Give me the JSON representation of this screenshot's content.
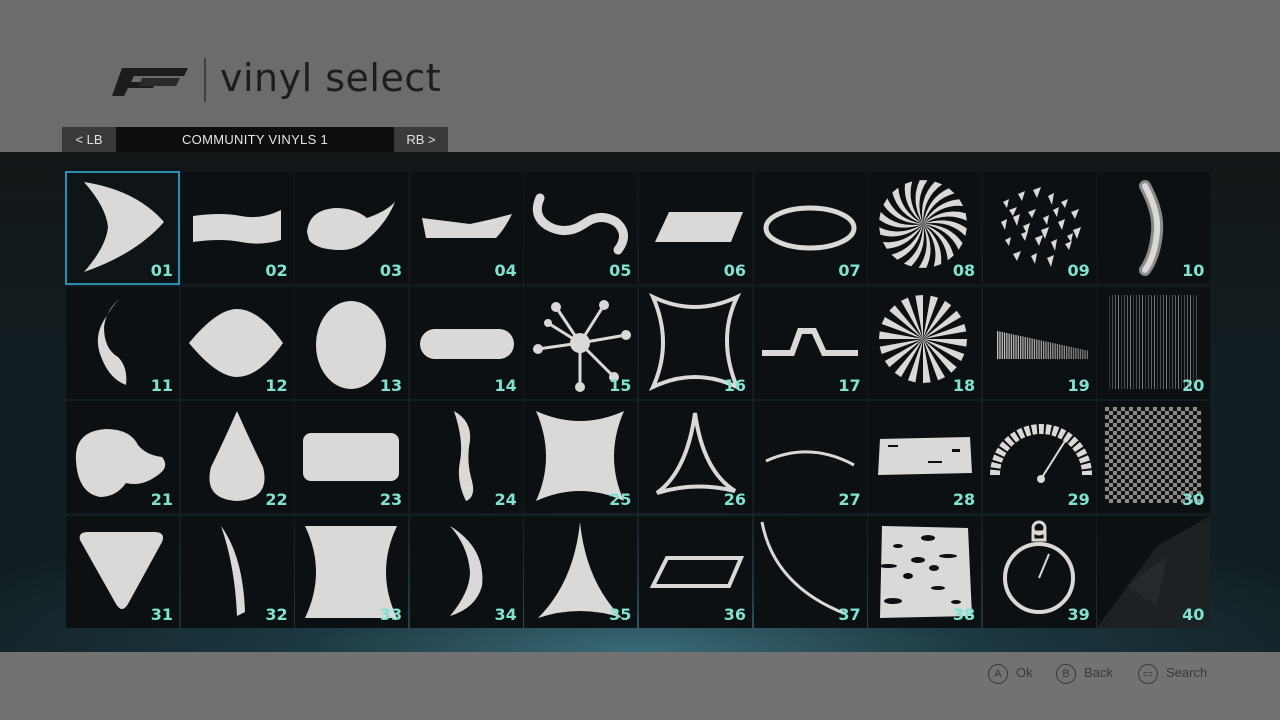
{
  "header": {
    "title": "vinyl select"
  },
  "tabs": {
    "left": "< LB",
    "current": "COMMUNITY VINYLS 1",
    "right": "RB >"
  },
  "vinyls": [
    {
      "num": "01",
      "icon": "chevron-shape-icon"
    },
    {
      "num": "02",
      "icon": "wavy-bar-icon"
    },
    {
      "num": "03",
      "icon": "swoosh-icon"
    },
    {
      "num": "04",
      "icon": "slant-bar-icon"
    },
    {
      "num": "05",
      "icon": "s-curve-icon"
    },
    {
      "num": "06",
      "icon": "parallelogram-icon"
    },
    {
      "num": "07",
      "icon": "ellipse-outline-icon"
    },
    {
      "num": "08",
      "icon": "spiral-icon"
    },
    {
      "num": "09",
      "icon": "shatter-icon"
    },
    {
      "num": "10",
      "icon": "tube-icon"
    },
    {
      "num": "11",
      "icon": "comma-curve-icon"
    },
    {
      "num": "12",
      "icon": "lemon-icon"
    },
    {
      "num": "13",
      "icon": "egg-icon"
    },
    {
      "num": "14",
      "icon": "capsule-icon"
    },
    {
      "num": "15",
      "icon": "splat-icon"
    },
    {
      "num": "16",
      "icon": "star-outline-icon"
    },
    {
      "num": "17",
      "icon": "step-line-icon"
    },
    {
      "num": "18",
      "icon": "sunburst-icon"
    },
    {
      "num": "19",
      "icon": "gradient-bars-icon"
    },
    {
      "num": "20",
      "icon": "vertical-lines-icon"
    },
    {
      "num": "21",
      "icon": "kidney-icon"
    },
    {
      "num": "22",
      "icon": "teardrop-icon"
    },
    {
      "num": "23",
      "icon": "rounded-rect-icon"
    },
    {
      "num": "24",
      "icon": "s-stroke-icon"
    },
    {
      "num": "25",
      "icon": "concave-square-icon"
    },
    {
      "num": "26",
      "icon": "tri-outline-icon"
    },
    {
      "num": "27",
      "icon": "arc-line-icon"
    },
    {
      "num": "28",
      "icon": "grunge-strip-icon"
    },
    {
      "num": "29",
      "icon": "gauge-icon"
    },
    {
      "num": "30",
      "icon": "checker-icon"
    },
    {
      "num": "31",
      "icon": "triangle-down-icon"
    },
    {
      "num": "32",
      "icon": "blade-curve-icon"
    },
    {
      "num": "33",
      "icon": "hourglass-icon"
    },
    {
      "num": "34",
      "icon": "crescent-icon"
    },
    {
      "num": "35",
      "icon": "concave-triangle-icon"
    },
    {
      "num": "36",
      "icon": "parallelogram-outline-icon"
    },
    {
      "num": "37",
      "icon": "quarter-arc-icon"
    },
    {
      "num": "38",
      "icon": "grunge-block-icon"
    },
    {
      "num": "39",
      "icon": "stopwatch-icon"
    },
    {
      "num": "40",
      "icon": "dark-shard-icon"
    }
  ],
  "footer": {
    "ok": {
      "key": "A",
      "label": "Ok"
    },
    "back": {
      "key": "B",
      "label": "Back"
    },
    "search": {
      "key": "▭",
      "label": "Search"
    }
  },
  "colors": {
    "accent": "#2a8fb0",
    "number": "#7fe3cf",
    "shape": "#d9d9d9"
  }
}
